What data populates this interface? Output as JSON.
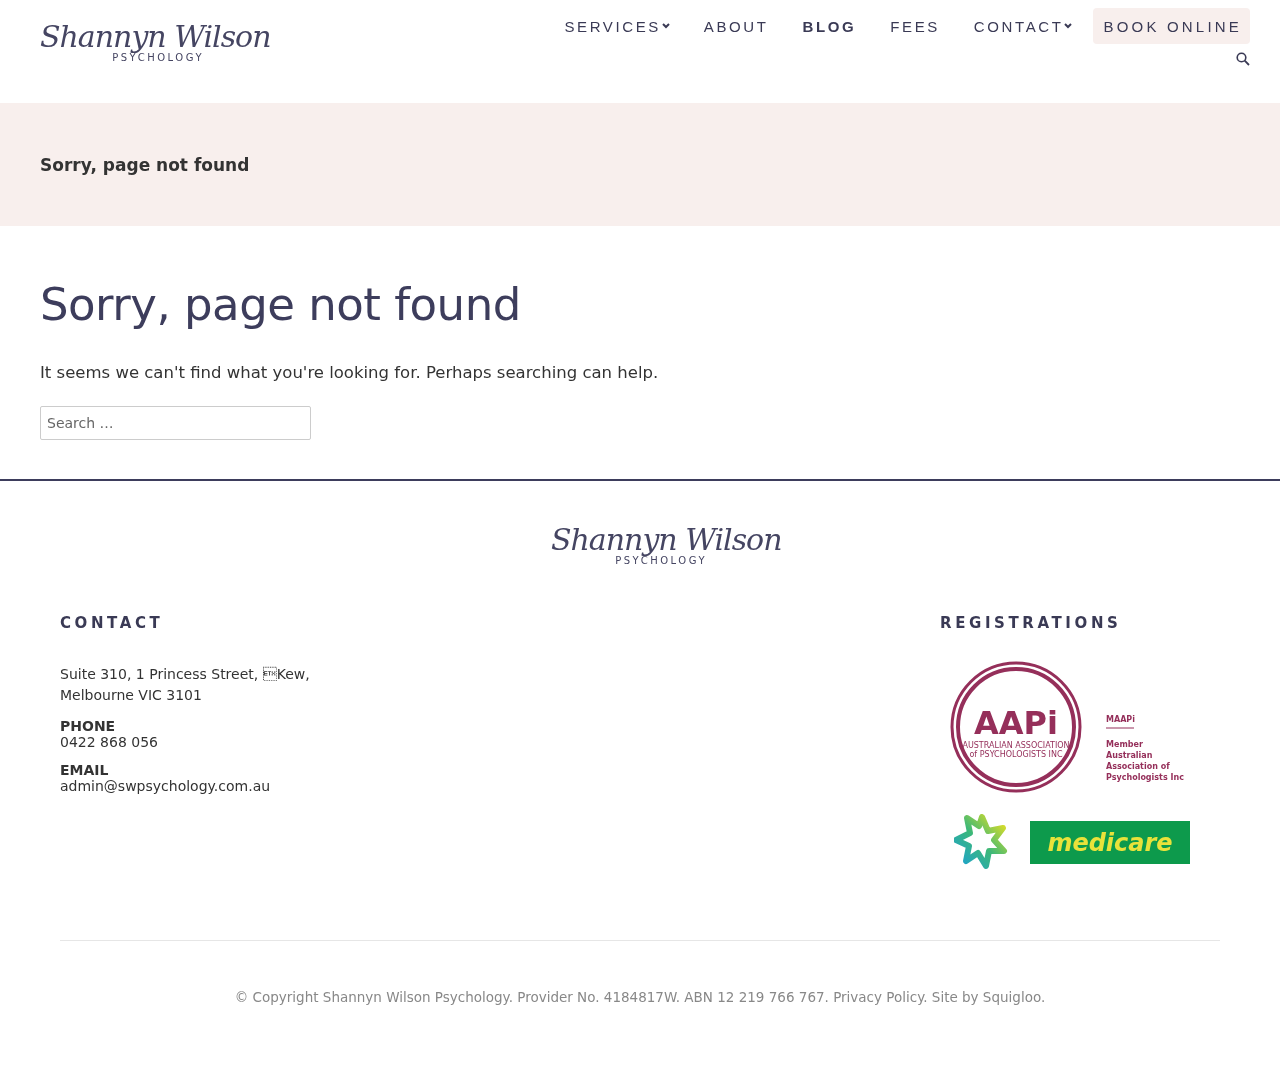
{
  "header": {
    "logo": {
      "script": "Shannyn Wilson",
      "sub": "PSYCHOLOGY"
    },
    "nav": [
      {
        "label": "SERVICES",
        "dropdown": true,
        "selected": false
      },
      {
        "label": "ABOUT",
        "dropdown": false,
        "selected": false
      },
      {
        "label": "BLOG",
        "dropdown": false,
        "selected": true
      },
      {
        "label": "FEES",
        "dropdown": false,
        "selected": false
      },
      {
        "label": "CONTACT",
        "dropdown": true,
        "selected": false
      }
    ],
    "cta": "BOOK ONLINE"
  },
  "banner": {
    "title": "Sorry, page not found"
  },
  "main": {
    "heading": "Sorry, page not found",
    "text": "It seems we can't find what you're looking for. Perhaps searching can help.",
    "search": {
      "placeholder": "Search …"
    }
  },
  "footer": {
    "logo": {
      "script": "Shannyn Wilson",
      "sub": "PSYCHOLOGY"
    },
    "contact": {
      "heading": "CONTACT",
      "address": [
        "Suite 310, 1 Princess Street, \u0003Kew,",
        "Melbourne VIC 3101"
      ],
      "items": [
        {
          "label": "PHONE",
          "value": "0422 868 056"
        },
        {
          "label": "EMAIL",
          "value": "admin@swpsychology.com.au"
        }
      ]
    },
    "registrations": {
      "heading": "REGISTRATIONS",
      "aapi": {
        "mark": "AAPi",
        "line1": "AUSTRALIAN ASSOCIATION",
        "line2": "of PSYCHOLOGISTS INC",
        "tag": "MAAPi",
        "caption": [
          "Member",
          "Australian",
          "Association of",
          "Psychologists Inc"
        ]
      },
      "medicare": "medicare"
    },
    "copyright": "© Copyright Shannyn Wilson Psychology. Provider No. 4184817W. ABN 12 219 766 767. Privacy Policy. Site by Squigloo."
  }
}
